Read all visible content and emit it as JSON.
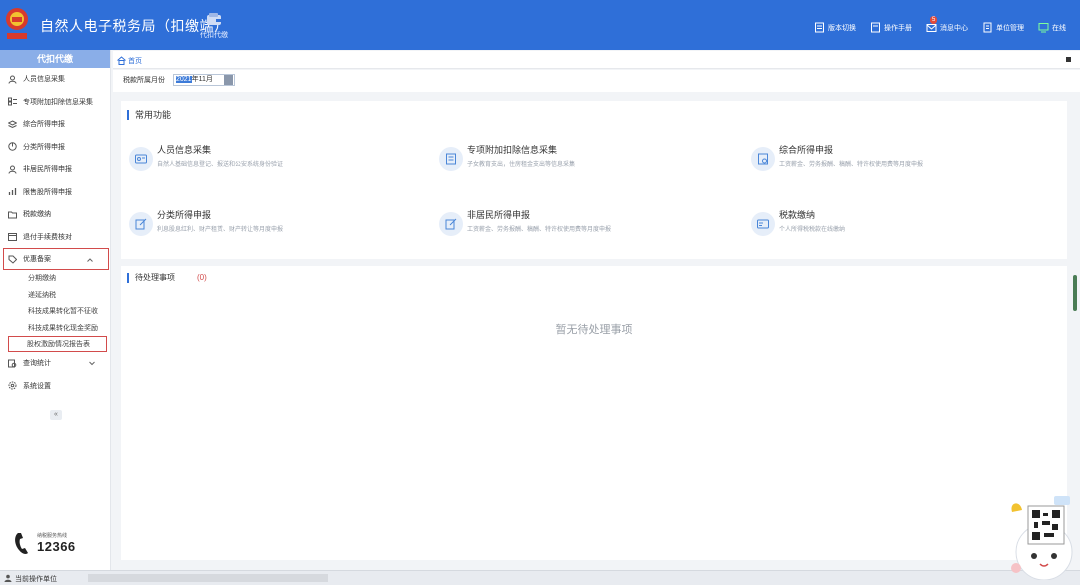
{
  "header": {
    "title": "自然人电子税务局（扣缴端）",
    "module_label": "代扣代缴",
    "tools": [
      {
        "name": "version-switch",
        "label": "版本切换"
      },
      {
        "name": "manual",
        "label": "操作手册"
      },
      {
        "name": "messages",
        "label": "消息中心",
        "badge": "5"
      },
      {
        "name": "unit-manage",
        "label": "单位管理"
      },
      {
        "name": "online",
        "label": "在线"
      }
    ]
  },
  "sidebar": {
    "header": "代扣代缴",
    "items": [
      {
        "label": "人员信息采集"
      },
      {
        "label": "专项附加扣除信息采集"
      },
      {
        "label": "综合所得申报"
      },
      {
        "label": "分类所得申报"
      },
      {
        "label": "非居民所得申报"
      },
      {
        "label": "限售股所得申报"
      },
      {
        "label": "税款缴纳"
      },
      {
        "label": "退付手续费核对"
      },
      {
        "label": "优惠备案"
      }
    ],
    "subitems": [
      {
        "label": "分期缴纳"
      },
      {
        "label": "递延纳税"
      },
      {
        "label": "科技成果转化暂不征收"
      },
      {
        "label": "科技成果转化现金奖励"
      },
      {
        "label": "股权激励情况报告表"
      }
    ],
    "after": [
      {
        "label": "查询统计"
      },
      {
        "label": "系统设置"
      }
    ],
    "collapse": "«",
    "hotline_caption": "纳税服务热线",
    "hotline_number": "12366"
  },
  "breadcrumb": {
    "home": "首页"
  },
  "period": {
    "label": "税款所属月份",
    "year": "2021",
    "month": "年11月"
  },
  "common": {
    "title": "常用功能",
    "functions": [
      {
        "title": "人员信息采集",
        "desc": "自然人基础信息登记、报送和公安系统身份验证"
      },
      {
        "title": "专项附加扣除信息采集",
        "desc": "子女教育支出，住房租金支出等信息采集"
      },
      {
        "title": "综合所得申报",
        "desc": "工资薪金、劳务报酬、稿酬、特许权使用费等月度申报"
      },
      {
        "title": "分类所得申报",
        "desc": "利息股息红利、财产租赁、财产转让等月度申报"
      },
      {
        "title": "非居民所得申报",
        "desc": "工资薪金、劳务报酬、稿酬、特许权使用费等月度申报"
      },
      {
        "title": "税款缴纳",
        "desc": "个人所得税税款在线缴纳"
      }
    ]
  },
  "todo": {
    "title": "待处理事项",
    "count": "(0)",
    "empty": "暂无待处理事项"
  },
  "status": {
    "label": "当前操作单位"
  },
  "colors": {
    "header": "#2f6fd8",
    "highlight": "#d24b4b",
    "side_head": "#8aaee8"
  }
}
